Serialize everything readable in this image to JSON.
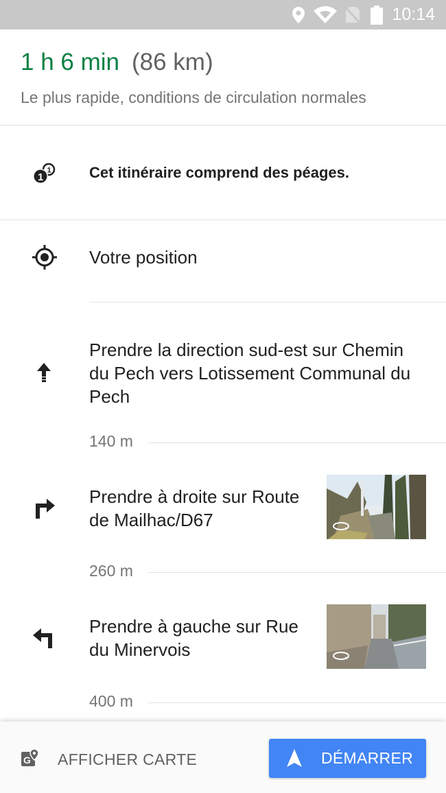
{
  "status_bar": {
    "time": "10:14",
    "icons": [
      "location-icon",
      "wifi-icon",
      "no-sim-icon",
      "battery-icon"
    ]
  },
  "summary": {
    "duration": "1 h 6 min",
    "distance": "(86 km)",
    "subtitle": "Le plus rapide, conditions de circulation normales"
  },
  "notice": {
    "icon": "toll-icon",
    "text": "Cet itinéraire comprend des péages."
  },
  "origin": {
    "icon": "my-location-icon",
    "label": "Votre position"
  },
  "steps": [
    {
      "icon": "straight-arrow-icon",
      "instruction": "Prendre la direction sud-est sur Chemin du Pech vers Lotissement Communal du Pech",
      "distance": "140 m"
    },
    {
      "icon": "turn-right-icon",
      "instruction": "Prendre à droite sur Route de Mailhac/D67",
      "distance": "260 m",
      "has_street_view": true
    },
    {
      "icon": "turn-left-icon",
      "instruction": "Prendre à gauche sur Rue du Minervois",
      "distance": "400 m",
      "has_street_view": true
    }
  ],
  "bottom_bar": {
    "map_label": "AFFICHER CARTE",
    "start_label": "DÉMARRER"
  },
  "colors": {
    "duration": "#0b8043",
    "accent": "#4285f4",
    "status_bar": "#c8c8c8"
  }
}
